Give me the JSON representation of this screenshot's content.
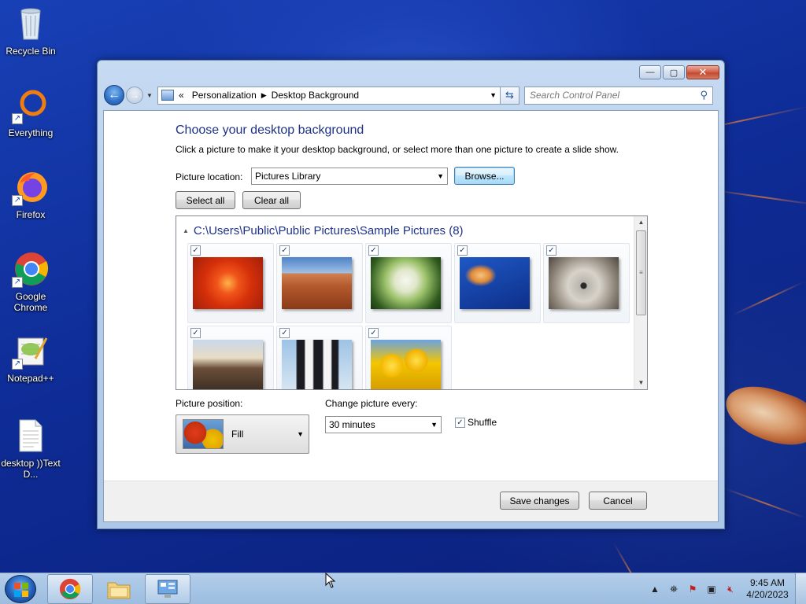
{
  "desktop": {
    "icons": [
      {
        "label": "Recycle Bin",
        "icon": "recycle-bin-icon"
      },
      {
        "label": "Everything",
        "icon": "everything-icon"
      },
      {
        "label": "Firefox",
        "icon": "firefox-icon"
      },
      {
        "label": "Google Chrome",
        "icon": "chrome-icon"
      },
      {
        "label": "Notepad++",
        "icon": "notepadpp-icon"
      },
      {
        "label": "desktop ))Text D...",
        "icon": "text-document-icon"
      }
    ]
  },
  "window": {
    "caption_buttons": {
      "minimize": "—",
      "maximize": "▢",
      "close": "✕"
    },
    "breadcrumb": {
      "prefix": "«",
      "items": [
        "Personalization",
        "Desktop Background"
      ],
      "separator": "▶"
    },
    "search": {
      "placeholder": "Search Control Panel"
    },
    "heading": "Choose your desktop background",
    "description": "Click a picture to make it your desktop background, or select more than one picture to create a slide show.",
    "picture_location": {
      "label": "Picture location:",
      "value": "Pictures Library"
    },
    "browse_label": "Browse...",
    "select_all_label": "Select all",
    "clear_all_label": "Clear all",
    "gallery": {
      "group_title": "C:\\Users\\Public\\Public Pictures\\Sample Pictures (8)",
      "pictures": [
        {
          "name": "chrysanthemum",
          "checked": true
        },
        {
          "name": "desert",
          "checked": true
        },
        {
          "name": "hydrangeas",
          "checked": true
        },
        {
          "name": "jellyfish",
          "checked": true
        },
        {
          "name": "koala",
          "checked": true
        },
        {
          "name": "lighthouse",
          "checked": true
        },
        {
          "name": "penguins",
          "checked": true
        },
        {
          "name": "tulips",
          "checked": true
        }
      ],
      "check_glyph": "✓"
    },
    "picture_position": {
      "label": "Picture position:",
      "value": "Fill"
    },
    "change_every": {
      "label": "Change picture every:",
      "value": "30 minutes"
    },
    "shuffle": {
      "label": "Shuffle",
      "checked": true
    },
    "save_label": "Save changes",
    "cancel_label": "Cancel"
  },
  "taskbar": {
    "clock_time": "9:45 AM",
    "clock_date": "4/20/2023",
    "tray_up_arrow": "▲"
  }
}
